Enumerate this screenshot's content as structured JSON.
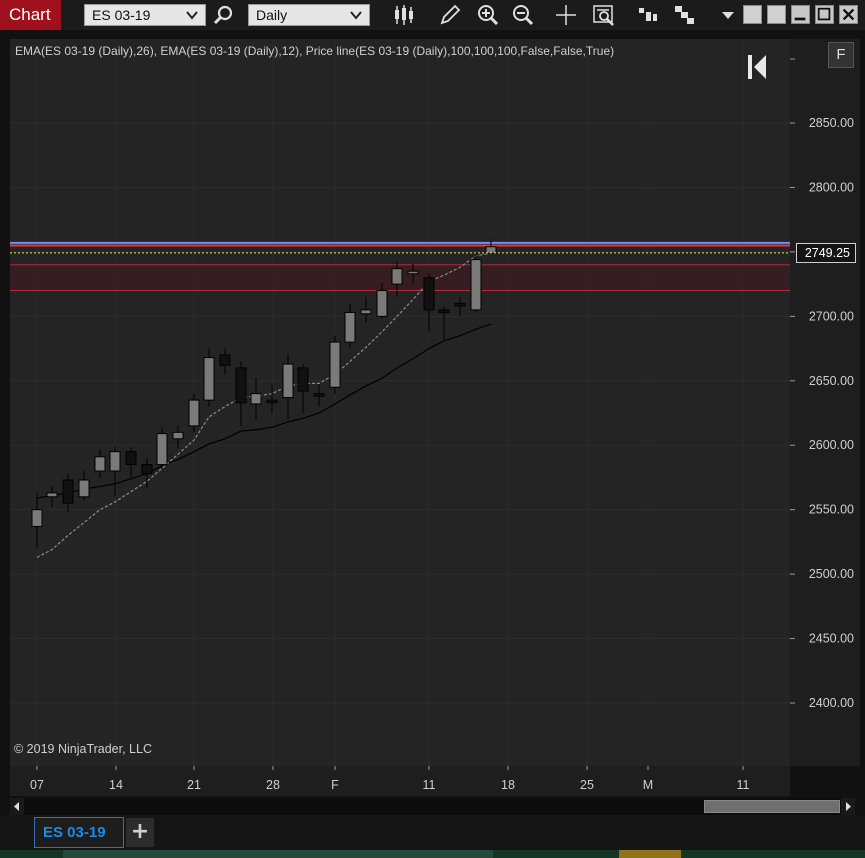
{
  "window": {
    "tab_label": "Chart"
  },
  "toolbar": {
    "instrument": "ES 03-19",
    "interval": "Daily"
  },
  "chart": {
    "indicator_label": "EMA(ES 03-19 (Daily),26), EMA(ES 03-19 (Daily),12), Price line(ES 03-19 (Daily),100,100,100,False,False,True)",
    "copyright": "© 2019 NinjaTrader, LLC",
    "f_button": "F",
    "price_label": "2749.25",
    "price_ticks": [
      "2850.00",
      "2800.00",
      "2750.00",
      "2700.00",
      "2650.00",
      "2600.00",
      "2550.00",
      "2500.00",
      "2450.00",
      "2400.00"
    ],
    "time_ticks": [
      "07",
      "14",
      "21",
      "28",
      "F",
      "11",
      "18",
      "25",
      "M",
      "11"
    ]
  },
  "chart_data": {
    "type": "candlestick",
    "y_range": [
      2365,
      2890
    ],
    "last_price": 2749.25,
    "colors": {
      "bull_body": "#7a7a7a",
      "bear_body": "#111111",
      "wick": "#000000",
      "ema12": "#8c8c8c",
      "ema26": "#000000",
      "price_line": "#e8e84a",
      "band": "#5a1a22"
    },
    "levels": {
      "blue_line": 2757,
      "red_line": 2755,
      "band_top": 2740,
      "band_bottom": 2720
    },
    "candles": [
      [
        2537,
        2550,
        2520,
        2563
      ],
      [
        2560,
        2563,
        2552,
        2568
      ],
      [
        2573,
        2555,
        2548,
        2578
      ],
      [
        2560,
        2573,
        2557,
        2580
      ],
      [
        2580,
        2591,
        2575,
        2597
      ],
      [
        2580,
        2595,
        2560,
        2599
      ],
      [
        2595,
        2585,
        2575,
        2598
      ],
      [
        2585,
        2578,
        2567,
        2590
      ],
      [
        2585,
        2609,
        2582,
        2614
      ],
      [
        2605,
        2610,
        2598,
        2615
      ],
      [
        2615,
        2635,
        2610,
        2640
      ],
      [
        2635,
        2668,
        2630,
        2675
      ],
      [
        2670,
        2662,
        2655,
        2675
      ],
      [
        2660,
        2633,
        2615,
        2665
      ],
      [
        2632,
        2640,
        2620,
        2652
      ],
      [
        2635,
        2633,
        2625,
        2647
      ],
      [
        2637,
        2663,
        2620,
        2670
      ],
      [
        2660,
        2642,
        2625,
        2663
      ],
      [
        2640,
        2638,
        2630,
        2647
      ],
      [
        2645,
        2680,
        2640,
        2685
      ],
      [
        2680,
        2703,
        2675,
        2710
      ],
      [
        2702,
        2705,
        2695,
        2715
      ],
      [
        2700,
        2720,
        2698,
        2726
      ],
      [
        2725,
        2737,
        2715,
        2742
      ],
      [
        2733,
        2735,
        2725,
        2741
      ],
      [
        2730,
        2705,
        2688,
        2733
      ],
      [
        2705,
        2703,
        2682,
        2708
      ],
      [
        2710,
        2708,
        2700,
        2715
      ],
      [
        2705,
        2744,
        2703,
        2750
      ],
      [
        2749,
        2754,
        2748,
        2760
      ]
    ],
    "candle_x": [
      37,
      52,
      68,
      84,
      100,
      115,
      131,
      147,
      162,
      178,
      194,
      209,
      225,
      241,
      256,
      272,
      288,
      303,
      319,
      335,
      350,
      366,
      382,
      397,
      413,
      429,
      444,
      460,
      476,
      491
    ],
    "ema12": [
      [
        37,
        2513
      ],
      [
        52,
        2519
      ],
      [
        68,
        2530
      ],
      [
        84,
        2540
      ],
      [
        100,
        2550
      ],
      [
        115,
        2556
      ],
      [
        131,
        2564
      ],
      [
        147,
        2572
      ],
      [
        162,
        2582
      ],
      [
        178,
        2593
      ],
      [
        194,
        2604
      ],
      [
        209,
        2622
      ],
      [
        225,
        2630
      ],
      [
        241,
        2637
      ],
      [
        256,
        2638
      ],
      [
        272,
        2640
      ],
      [
        288,
        2646
      ],
      [
        303,
        2648
      ],
      [
        319,
        2648
      ],
      [
        335,
        2655
      ],
      [
        350,
        2665
      ],
      [
        366,
        2676
      ],
      [
        382,
        2688
      ],
      [
        397,
        2700
      ],
      [
        413,
        2713
      ],
      [
        429,
        2727
      ],
      [
        444,
        2732
      ],
      [
        460,
        2738
      ],
      [
        476,
        2747
      ],
      [
        491,
        2749
      ]
    ],
    "ema26": [
      [
        37,
        2559
      ],
      [
        52,
        2561
      ],
      [
        68,
        2563
      ],
      [
        84,
        2566
      ],
      [
        100,
        2568
      ],
      [
        115,
        2570
      ],
      [
        131,
        2574
      ],
      [
        147,
        2578
      ],
      [
        162,
        2584
      ],
      [
        178,
        2589
      ],
      [
        194,
        2595
      ],
      [
        209,
        2601
      ],
      [
        225,
        2605
      ],
      [
        241,
        2611
      ],
      [
        256,
        2612
      ],
      [
        272,
        2614
      ],
      [
        288,
        2618
      ],
      [
        303,
        2621
      ],
      [
        319,
        2625
      ],
      [
        335,
        2632
      ],
      [
        350,
        2639
      ],
      [
        366,
        2646
      ],
      [
        382,
        2652
      ],
      [
        397,
        2660
      ],
      [
        413,
        2667
      ],
      [
        429,
        2675
      ],
      [
        444,
        2681
      ],
      [
        460,
        2685
      ],
      [
        476,
        2690
      ],
      [
        491,
        2694
      ]
    ]
  }
}
